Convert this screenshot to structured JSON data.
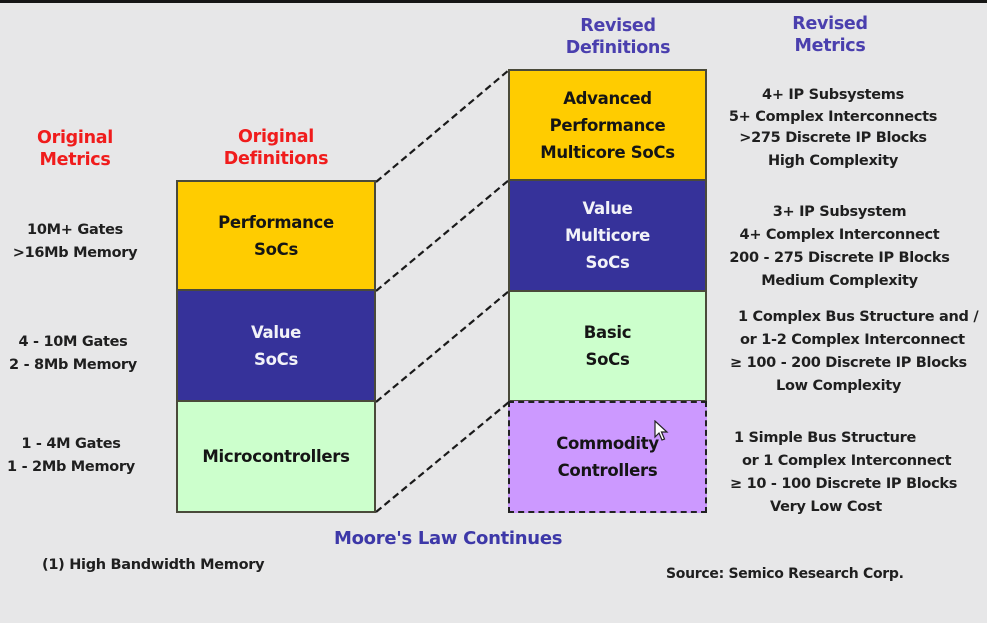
{
  "headers": {
    "original_metrics": [
      "Original",
      "Metrics"
    ],
    "original_definitions": [
      "Original",
      "Definitions"
    ],
    "revised_definitions": [
      "Revised",
      "Definitions"
    ],
    "revised_metrics": [
      "Revised",
      "Metrics"
    ]
  },
  "original_metrics": [
    [
      "10M+ Gates",
      ">16Mb Memory"
    ],
    [
      "4 - 10M Gates",
      "2 - 8Mb Memory"
    ],
    [
      "1 - 4M Gates",
      "1 - 2Mb Memory"
    ]
  ],
  "original_definitions": [
    {
      "label": "Performance\nSoCs",
      "color": "#ffcc00"
    },
    {
      "label": "Value\nSoCs",
      "color": "#36329a"
    },
    {
      "label": "Microcontrollers",
      "color": "#ccffcc"
    }
  ],
  "revised_definitions": [
    {
      "label": "Advanced\nPerformance\nMulticore  SoCs",
      "color": "#ffcc00"
    },
    {
      "label": "Value\nMulticore\nSoCs",
      "color": "#36329a"
    },
    {
      "label": "Basic\nSoCs",
      "color": "#ccffcc"
    },
    {
      "label": "Commodity\nControllers",
      "color": "#cc99ff"
    }
  ],
  "revised_metrics": [
    [
      "4+ IP Subsystems",
      "5+ Complex Interconnects",
      ">275 Discrete IP Blocks",
      "High Complexity"
    ],
    [
      "3+ IP Subsystem",
      "4+ Complex Interconnect",
      "200 - 275 Discrete IP Blocks",
      "Medium Complexity"
    ],
    [
      "1 Complex Bus Structure and /",
      "or 1-2 Complex Interconnect",
      "≥  100 - 200 Discrete IP Blocks",
      "Low Complexity"
    ],
    [
      "1 Simple Bus Structure",
      "or 1 Complex Interconnect",
      "≥ 10 - 100 Discrete IP Blocks",
      "Very Low Cost"
    ]
  ],
  "footer": {
    "moores_law": "Moore's Law Continues",
    "footnote": "(1) High Bandwidth Memory",
    "source": "Source: Semico Research Corp."
  },
  "icons": {
    "cursor": "mouse-pointer-icon"
  }
}
